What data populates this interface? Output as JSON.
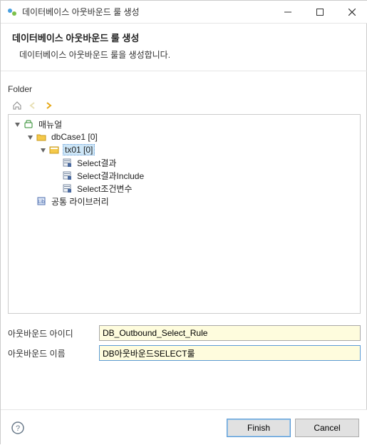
{
  "window": {
    "title": "데이터베이스 아웃바운드 룰 생성"
  },
  "header": {
    "title": "데이터베이스 아웃바운드 룰 생성",
    "subtitle": "데이터베이스 아웃바운드 룰을 생성합니다."
  },
  "folder_section": {
    "label": "Folder"
  },
  "tree": {
    "root": {
      "label": "매뉴얼",
      "children": {
        "dbcase": {
          "label": "dbCase1 [0]",
          "children": {
            "tx": {
              "label": "tx01 [0]",
              "children": {
                "c0": "Select결과",
                "c1": "Select결과Include",
                "c2": "Select조건변수"
              }
            }
          }
        },
        "lib": {
          "label": "공통 라이브러리"
        }
      }
    }
  },
  "form": {
    "id_label": "아웃바운드 아이디",
    "id_value": "DB_Outbound_Select_Rule",
    "name_label": "아웃바운드 이름",
    "name_value": "DB아웃바운드SELECT룰"
  },
  "footer": {
    "finish": "Finish",
    "cancel": "Cancel"
  }
}
